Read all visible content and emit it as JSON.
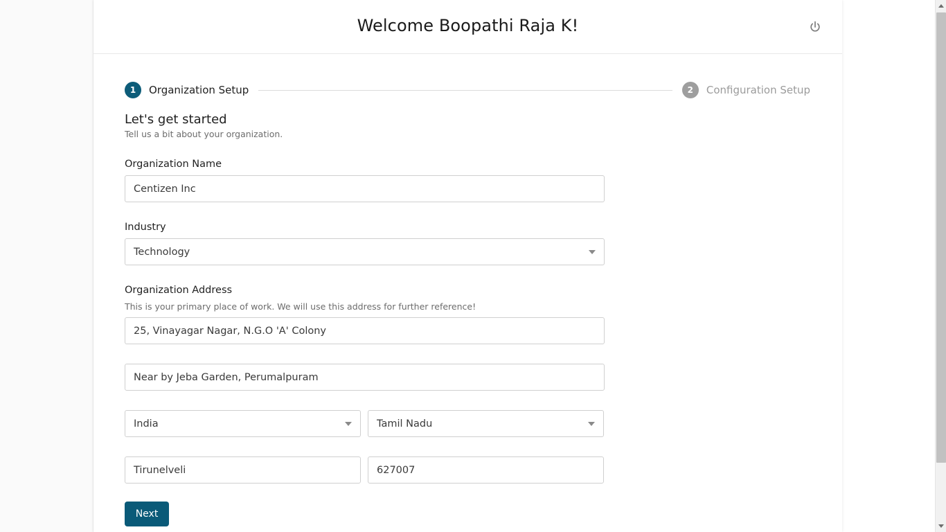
{
  "header": {
    "title": "Welcome Boopathi Raja K!",
    "power_icon": "power-icon"
  },
  "stepper": {
    "steps": [
      {
        "number": "1",
        "label": "Organization Setup",
        "state": "active"
      },
      {
        "number": "2",
        "label": "Configuration Setup",
        "state": "inactive"
      }
    ]
  },
  "form": {
    "section_title": "Let's get started",
    "section_subtitle": "Tell us a bit about your organization.",
    "organization_name": {
      "label": "Organization Name",
      "value": "Centizen Inc"
    },
    "industry": {
      "label": "Industry",
      "value": "Technology",
      "caret_icon": "chevron-down-icon"
    },
    "address": {
      "label": "Organization Address",
      "hint": "This is your primary place of work. We will use this address for further reference!",
      "line1": "25, Vinayagar Nagar, N.G.O 'A' Colony",
      "line2": "Near by Jeba Garden, Perumalpuram",
      "country": "India",
      "state": "Tamil Nadu",
      "city": "Tirunelveli",
      "zip": "627007"
    },
    "next_button": "Next"
  },
  "scrollbar": {
    "up_icon": "scroll-up-arrow-icon",
    "down_icon": "scroll-down-arrow-icon"
  },
  "colors": {
    "accent": "#0a5a78",
    "step_active": "#0d5c79",
    "step_inactive": "#9e9e9e",
    "border": "#cfcfcf"
  }
}
